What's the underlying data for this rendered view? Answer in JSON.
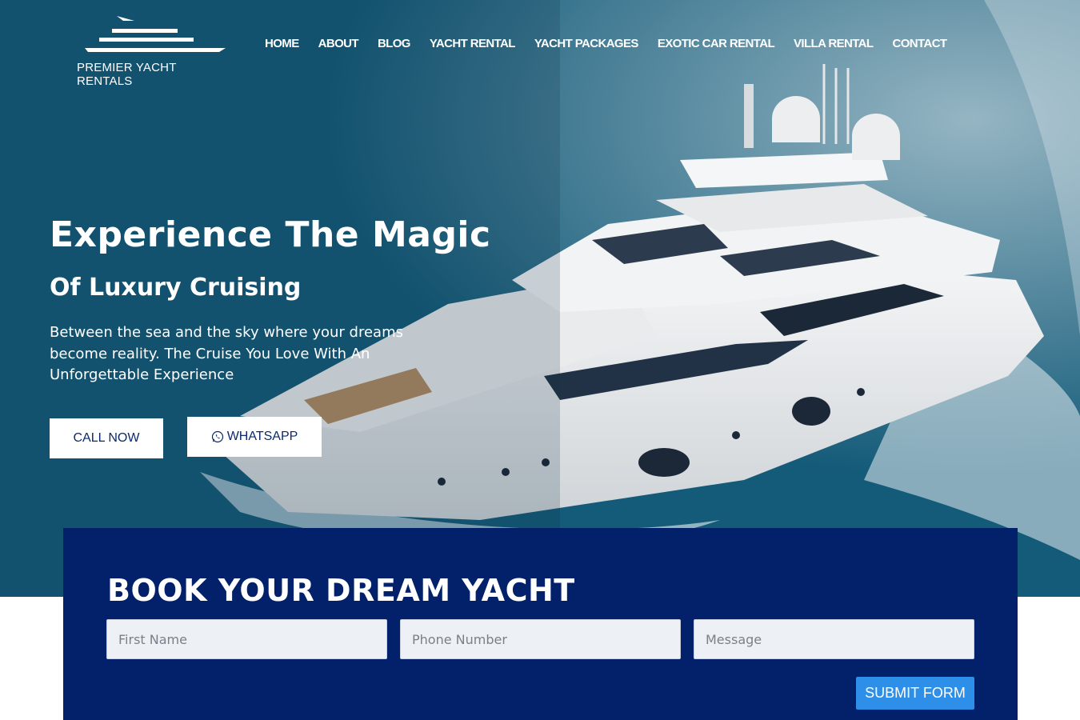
{
  "brand": {
    "name": "PREMIER YACHT RENTALS"
  },
  "nav": {
    "items": [
      "HOME",
      "ABOUT",
      "BLOG",
      "YACHT RENTAL",
      "YACHT PACKAGES",
      "EXOTIC CAR RENTAL",
      "VILLA RENTAL",
      "CONTACT"
    ]
  },
  "hero": {
    "title": "Experience The Magic",
    "subtitle": "Of Luxury Cruising",
    "description": "Between the sea and the sky where your dreams become reality. The Cruise You Love With An Unforgettable Experience",
    "call_label": "CALL NOW",
    "whatsapp_label": "WHATSAPP",
    "whatsapp_icon": "whatsapp-icon"
  },
  "booking": {
    "title": "BOOK YOUR DREAM YACHT",
    "first_name_placeholder": "First Name",
    "phone_placeholder": "Phone Number",
    "message_placeholder": "Message",
    "submit_label": "SUBMIT FORM"
  },
  "colors": {
    "panel": "#03216b",
    "submit": "#2e8fe8",
    "ocean": "#135a78",
    "button_text": "#0b2a6b"
  }
}
